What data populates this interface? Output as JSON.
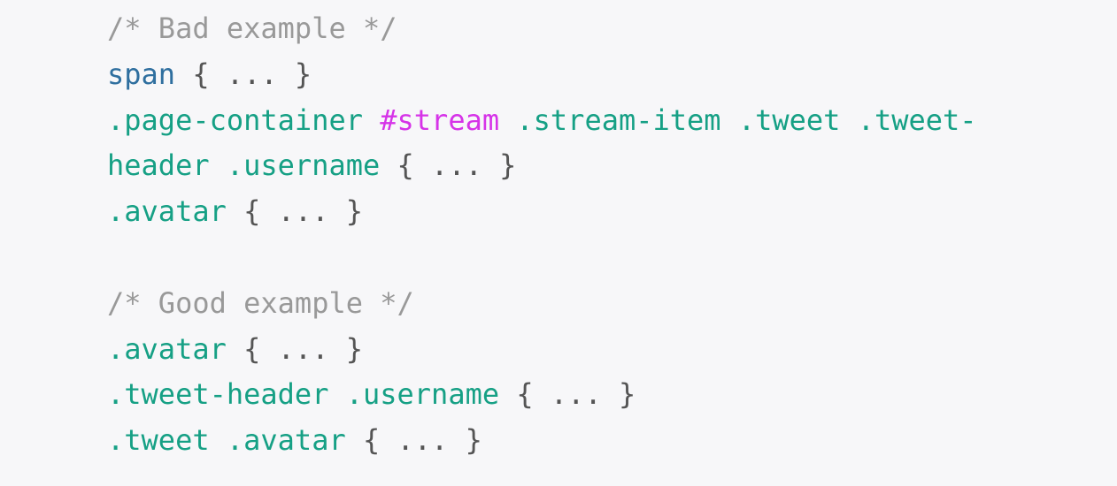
{
  "code_block": {
    "colors": {
      "comment": "#999999",
      "tag": "#2f6f9f",
      "class": "#16a085",
      "id": "#d633e8",
      "punctuation": "#555555",
      "background": "#f7f7f9"
    },
    "lines": [
      [
        {
          "t": "comment",
          "v": "/* Bad example */"
        }
      ],
      [
        {
          "t": "tag",
          "v": "span"
        },
        {
          "t": "punct",
          "v": " { ... }"
        }
      ],
      [
        {
          "t": "cls",
          "v": ".page-container "
        },
        {
          "t": "id",
          "v": "#stream"
        },
        {
          "t": "cls",
          "v": " .stream-item .tweet .tweet-"
        }
      ],
      [
        {
          "t": "cls",
          "v": "header .username"
        },
        {
          "t": "punct",
          "v": " { ... }"
        }
      ],
      [
        {
          "t": "cls",
          "v": ".avatar"
        },
        {
          "t": "punct",
          "v": " { ... }"
        }
      ],
      [],
      [
        {
          "t": "comment",
          "v": "/* Good example */"
        }
      ],
      [
        {
          "t": "cls",
          "v": ".avatar"
        },
        {
          "t": "punct",
          "v": " { ... }"
        }
      ],
      [
        {
          "t": "cls",
          "v": ".tweet-header .username"
        },
        {
          "t": "punct",
          "v": " { ... }"
        }
      ],
      [
        {
          "t": "cls",
          "v": ".tweet .avatar"
        },
        {
          "t": "punct",
          "v": " { ... }"
        }
      ]
    ]
  }
}
